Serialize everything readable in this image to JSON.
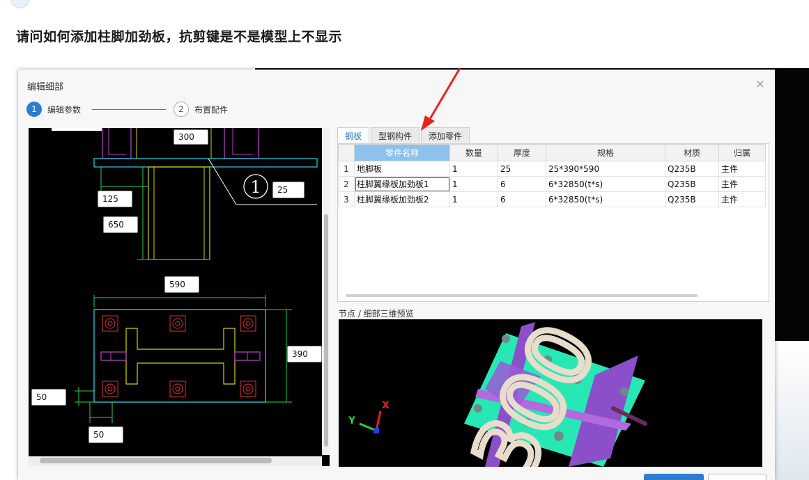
{
  "question": {
    "title": "请问如何添加柱脚加劲板，抗剪键是不是模型上不显示"
  },
  "dialog": {
    "title": "编辑细部",
    "close_glyph": "×",
    "steps": [
      {
        "number": "1",
        "label": "编辑参数"
      },
      {
        "number": "2",
        "label": "布置配件"
      }
    ]
  },
  "drawing": {
    "dims": {
      "d300": "300",
      "d25": "25",
      "d125": "125",
      "d650": "650",
      "d590": "590",
      "d390": "390",
      "d50a": "50",
      "d50b": "50"
    },
    "marker": "1"
  },
  "tabs": [
    "钢板",
    "型钢构件",
    "添加零件"
  ],
  "table": {
    "columns": [
      "零件名称",
      "数量",
      "厚度",
      "规格",
      "材质",
      "归属"
    ],
    "rows": [
      {
        "index": "1",
        "name": "地脚板",
        "qty": "1",
        "thickness": "25",
        "spec": "25*390*590",
        "material": "Q235B",
        "owner": "主件"
      },
      {
        "index": "2",
        "name": "柱脚翼缘板加劲板1",
        "qty": "1",
        "thickness": "6",
        "spec": "6*32850(t*s)",
        "material": "Q235B",
        "owner": "主件"
      },
      {
        "index": "3",
        "name": "柱脚翼缘板加劲板2",
        "qty": "1",
        "thickness": "6",
        "spec": "6*32850(t*s)",
        "material": "Q235B",
        "owner": "主件"
      }
    ]
  },
  "preview": {
    "label": "节点 / 细部三维预览",
    "overlay_text": "300",
    "axis_x": "X",
    "axis_y": "Y"
  },
  "colors": {
    "accent": "#2d7dd2",
    "annotation_arrow": "#e8231d",
    "plate_green": "#27e8b4",
    "plate_purple": "#8b4fc9"
  }
}
